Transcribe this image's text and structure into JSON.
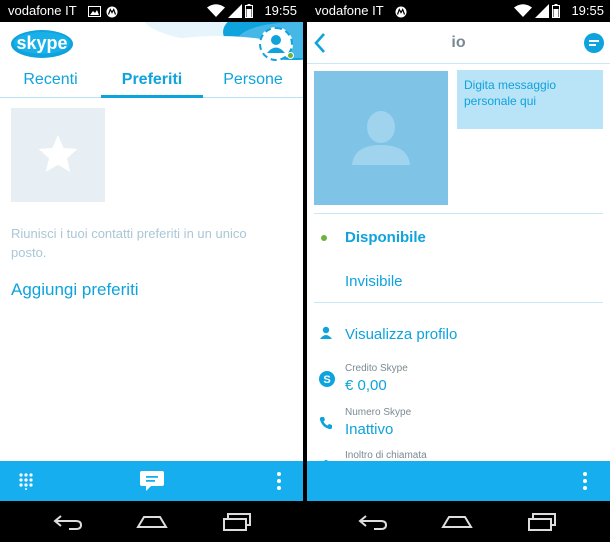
{
  "status_bar": {
    "carrier": "vodafone IT",
    "time": "19:55"
  },
  "left": {
    "tabs": [
      "Recenti",
      "Preferiti",
      "Persone"
    ],
    "active_tab": "Preferiti",
    "empty_message": "Riunisci i tuoi contatti preferiti in un unico posto.",
    "add_favorites_link": "Aggiungi preferiti"
  },
  "right": {
    "title": "io",
    "mood_placeholder": "Digita messaggio personale qui",
    "status_available": "Disponibile",
    "status_invisible": "Invisibile",
    "view_profile": "Visualizza profilo",
    "credit_label": "Credito Skype",
    "credit_value": "€ 0,00",
    "number_label": "Numero Skype",
    "number_value": "Inattivo",
    "forward_label": "Inoltro di chiamata"
  },
  "colors": {
    "accent": "#0ea3dd",
    "bar": "#17aef0",
    "online": "#6cb33f"
  }
}
